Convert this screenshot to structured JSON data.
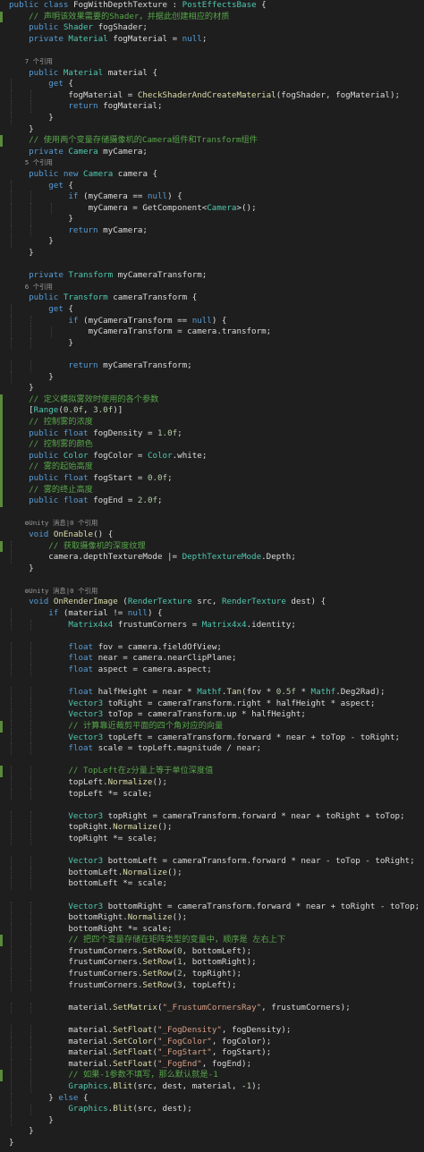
{
  "editor": {
    "lines": [
      {
        "g": "",
        "t": "public class FogWithDepthTexture : PostEffectsBase {",
        "c": "tx"
      },
      {
        "g": "changed",
        "t": "    // 声明该效果需要的Shader，并据此创建相应的材质",
        "c": "cm"
      },
      {
        "g": "",
        "t": "    public Shader fogShader;",
        "c": "tx"
      },
      {
        "g": "",
        "t": "    private Material fogMaterial = null;",
        "c": "tx"
      },
      {
        "g": "",
        "t": "",
        "c": "tx"
      },
      {
        "g": "",
        "t": "    7 个引用",
        "c": "ref"
      },
      {
        "g": "",
        "t": "    public Material material {",
        "c": "tx"
      },
      {
        "g": "",
        "t": "        get {",
        "c": "tx"
      },
      {
        "g": "",
        "t": "            fogMaterial = CheckShaderAndCreateMaterial(fogShader, fogMaterial);",
        "c": "tx"
      },
      {
        "g": "",
        "t": "            return fogMaterial;",
        "c": "tx"
      },
      {
        "g": "",
        "t": "        }",
        "c": "tx"
      },
      {
        "g": "",
        "t": "    }",
        "c": "tx"
      },
      {
        "g": "changed",
        "t": "    // 使用两个变量存储摄像机的Camera组件和Transform组件",
        "c": "cm"
      },
      {
        "g": "",
        "t": "    private Camera myCamera;",
        "c": "tx"
      },
      {
        "g": "",
        "t": "    5 个引用",
        "c": "ref"
      },
      {
        "g": "",
        "t": "    public new Camera camera {",
        "c": "tx"
      },
      {
        "g": "",
        "t": "        get {",
        "c": "tx"
      },
      {
        "g": "",
        "t": "            if (myCamera == null) {",
        "c": "tx"
      },
      {
        "g": "",
        "t": "                myCamera = GetComponent<Camera>();",
        "c": "tx"
      },
      {
        "g": "",
        "t": "            }",
        "c": "tx"
      },
      {
        "g": "",
        "t": "            return myCamera;",
        "c": "tx"
      },
      {
        "g": "",
        "t": "        }",
        "c": "tx"
      },
      {
        "g": "",
        "t": "    }",
        "c": "tx"
      },
      {
        "g": "",
        "t": "",
        "c": "tx"
      },
      {
        "g": "",
        "t": "    private Transform myCameraTransform;",
        "c": "tx"
      },
      {
        "g": "",
        "t": "    6 个引用",
        "c": "ref"
      },
      {
        "g": "",
        "t": "    public Transform cameraTransform {",
        "c": "tx"
      },
      {
        "g": "",
        "t": "        get {",
        "c": "tx"
      },
      {
        "g": "",
        "t": "            if (myCameraTransform == null) {",
        "c": "tx"
      },
      {
        "g": "",
        "t": "                myCameraTransform = camera.transform;",
        "c": "tx"
      },
      {
        "g": "",
        "t": "            }",
        "c": "tx"
      },
      {
        "g": "",
        "t": "",
        "c": "tx"
      },
      {
        "g": "",
        "t": "            return myCameraTransform;",
        "c": "tx"
      },
      {
        "g": "",
        "t": "        }",
        "c": "tx"
      },
      {
        "g": "",
        "t": "    }",
        "c": "tx"
      },
      {
        "g": "changed",
        "t": "    // 定义模拟雾效时使用的各个参数",
        "c": "cm"
      },
      {
        "g": "changed",
        "t": "    [Range(0.0f, 3.0f)]",
        "c": "tx"
      },
      {
        "g": "changed",
        "t": "    // 控制雾的浓度",
        "c": "cm"
      },
      {
        "g": "changed",
        "t": "    public float fogDensity = 1.0f;",
        "c": "tx"
      },
      {
        "g": "changed",
        "t": "    // 控制雾的颜色",
        "c": "cm"
      },
      {
        "g": "changed",
        "t": "    public Color fogColor = Color.white;",
        "c": "tx"
      },
      {
        "g": "changed",
        "t": "    // 雾的起始高度",
        "c": "cm"
      },
      {
        "g": "changed",
        "t": "    public float fogStart = 0.0f;",
        "c": "tx"
      },
      {
        "g": "changed",
        "t": "    // 雾的终止高度",
        "c": "cm"
      },
      {
        "g": "changed",
        "t": "    public float fogEnd = 2.0f;",
        "c": "tx"
      },
      {
        "g": "",
        "t": "",
        "c": "tx"
      },
      {
        "g": "",
        "t": "    ⚙Unity 消息|0 个引用",
        "c": "ref"
      },
      {
        "g": "",
        "t": "    void OnEnable() {",
        "c": "tx"
      },
      {
        "g": "changed",
        "t": "        // 获取摄像机的深度纹理",
        "c": "cm"
      },
      {
        "g": "",
        "t": "        camera.depthTextureMode |= DepthTextureMode.Depth;",
        "c": "tx"
      },
      {
        "g": "",
        "t": "    }",
        "c": "tx"
      },
      {
        "g": "",
        "t": "",
        "c": "tx"
      },
      {
        "g": "",
        "t": "    ⚙Unity 消息|0 个引用",
        "c": "ref"
      },
      {
        "g": "",
        "t": "    void OnRenderImage (RenderTexture src, RenderTexture dest) {",
        "c": "tx"
      },
      {
        "g": "",
        "t": "        if (material != null) {",
        "c": "tx"
      },
      {
        "g": "",
        "t": "            Matrix4x4 frustumCorners = Matrix4x4.identity;",
        "c": "tx"
      },
      {
        "g": "",
        "t": "",
        "c": "tx"
      },
      {
        "g": "",
        "t": "            float fov = camera.fieldOfView;",
        "c": "tx"
      },
      {
        "g": "",
        "t": "            float near = camera.nearClipPlane;",
        "c": "tx"
      },
      {
        "g": "",
        "t": "            float aspect = camera.aspect;",
        "c": "tx"
      },
      {
        "g": "",
        "t": "",
        "c": "tx"
      },
      {
        "g": "",
        "t": "            float halfHeight = near * Mathf.Tan(fov * 0.5f * Mathf.Deg2Rad);",
        "c": "tx"
      },
      {
        "g": "",
        "t": "            Vector3 toRight = cameraTransform.right * halfHeight * aspect;",
        "c": "tx"
      },
      {
        "g": "",
        "t": "            Vector3 toTop = cameraTransform.up * halfHeight;",
        "c": "tx"
      },
      {
        "g": "changed",
        "t": "            // 计算靠近裁剪平面的四个角对应的向量",
        "c": "cm"
      },
      {
        "g": "",
        "t": "            Vector3 topLeft = cameraTransform.forward * near + toTop - toRight;",
        "c": "tx"
      },
      {
        "g": "",
        "t": "            float scale = topLeft.magnitude / near;",
        "c": "tx"
      },
      {
        "g": "",
        "t": "",
        "c": "tx"
      },
      {
        "g": "changed",
        "t": "            // TopLeft在z分量上等于单位深度值",
        "c": "cm"
      },
      {
        "g": "",
        "t": "            topLeft.Normalize();",
        "c": "tx"
      },
      {
        "g": "",
        "t": "            topLeft *= scale;",
        "c": "tx"
      },
      {
        "g": "",
        "t": "",
        "c": "tx"
      },
      {
        "g": "",
        "t": "            Vector3 topRight = cameraTransform.forward * near + toRight + toTop;",
        "c": "tx"
      },
      {
        "g": "",
        "t": "            topRight.Normalize();",
        "c": "tx"
      },
      {
        "g": "",
        "t": "            topRight *= scale;",
        "c": "tx"
      },
      {
        "g": "",
        "t": "",
        "c": "tx"
      },
      {
        "g": "",
        "t": "            Vector3 bottomLeft = cameraTransform.forward * near - toTop - toRight;",
        "c": "tx"
      },
      {
        "g": "",
        "t": "            bottomLeft.Normalize();",
        "c": "tx"
      },
      {
        "g": "",
        "t": "            bottomLeft *= scale;",
        "c": "tx"
      },
      {
        "g": "",
        "t": "",
        "c": "tx"
      },
      {
        "g": "",
        "t": "            Vector3 bottomRight = cameraTransform.forward * near + toRight - toTop;",
        "c": "tx"
      },
      {
        "g": "",
        "t": "            bottomRight.Normalize();",
        "c": "tx"
      },
      {
        "g": "",
        "t": "            bottomRight *= scale;",
        "c": "tx"
      },
      {
        "g": "changed",
        "t": "            // 把四个变量存储在矩阵类型的变量中，顺序是 左右上下",
        "c": "cm"
      },
      {
        "g": "",
        "t": "            frustumCorners.SetRow(0, bottomLeft);",
        "c": "tx"
      },
      {
        "g": "",
        "t": "            frustumCorners.SetRow(1, bottomRight);",
        "c": "tx"
      },
      {
        "g": "",
        "t": "            frustumCorners.SetRow(2, topRight);",
        "c": "tx"
      },
      {
        "g": "",
        "t": "            frustumCorners.SetRow(3, topLeft);",
        "c": "tx"
      },
      {
        "g": "",
        "t": "",
        "c": "tx"
      },
      {
        "g": "",
        "t": "            material.SetMatrix(\"_FrustumCornersRay\", frustumCorners);",
        "c": "tx"
      },
      {
        "g": "",
        "t": "",
        "c": "tx"
      },
      {
        "g": "",
        "t": "            material.SetFloat(\"_FogDensity\", fogDensity);",
        "c": "tx"
      },
      {
        "g": "",
        "t": "            material.SetColor(\"_FogColor\", fogColor);",
        "c": "tx"
      },
      {
        "g": "",
        "t": "            material.SetFloat(\"_FogStart\", fogStart);",
        "c": "tx"
      },
      {
        "g": "",
        "t": "            material.SetFloat(\"_FogEnd\", fogEnd);",
        "c": "tx"
      },
      {
        "g": "changed",
        "t": "            // 如果-1参数不填写，那么默认就是-1",
        "c": "cm"
      },
      {
        "g": "",
        "t": "            Graphics.Blit(src, dest, material, -1);",
        "c": "tx"
      },
      {
        "g": "",
        "t": "        } else {",
        "c": "tx"
      },
      {
        "g": "",
        "t": "            Graphics.Blit(src, dest);",
        "c": "tx"
      },
      {
        "g": "",
        "t": "        }",
        "c": "tx"
      },
      {
        "g": "",
        "t": "    }",
        "c": "tx"
      },
      {
        "g": "",
        "t": "}",
        "c": "tx"
      }
    ],
    "colors": {
      "background": "#1e1e1e",
      "keyword": "#569cd6",
      "type": "#4ec9b0",
      "comment": "#57a64a",
      "string": "#d69d85",
      "number": "#b5cea8",
      "method": "#dcdcaa",
      "text": "#dcdcdc",
      "changed_marker": "#5a8a3c"
    }
  }
}
